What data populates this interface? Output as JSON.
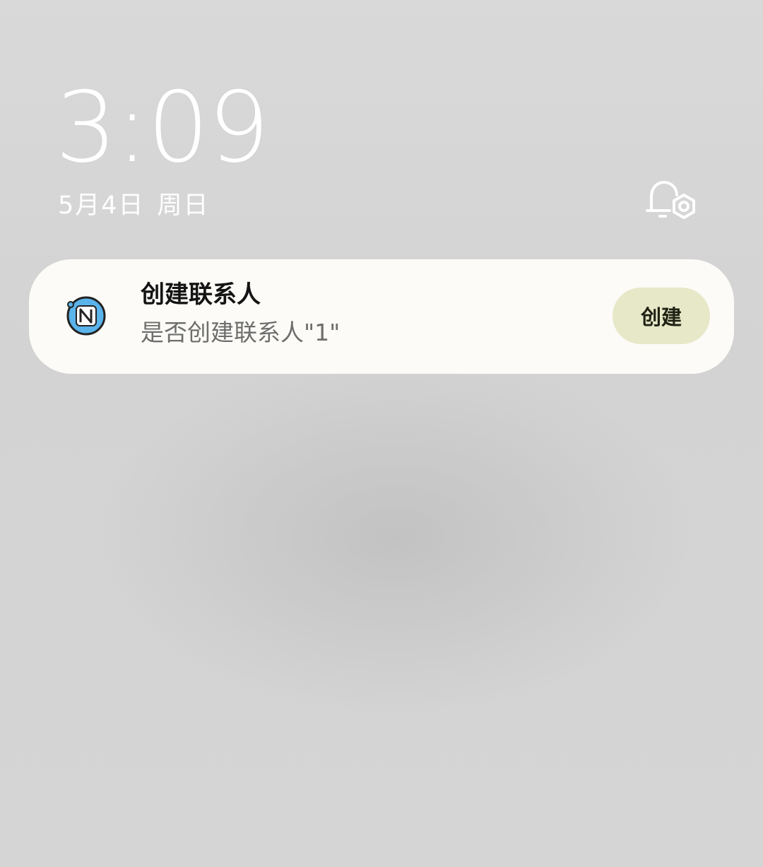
{
  "lockscreen": {
    "time": "3:09",
    "date": "5月4日",
    "weekday": "周日",
    "settings_icon": "bell-gear-icon"
  },
  "notification": {
    "app_icon": "nfc-icon",
    "title": "创建联系人",
    "body": "是否创建联系人\"1\"",
    "action_label": "创建",
    "colors": {
      "card_bg": "#fcfbf7",
      "action_bg": "#e6e8c8",
      "icon_accent": "#5ab3ea"
    }
  }
}
